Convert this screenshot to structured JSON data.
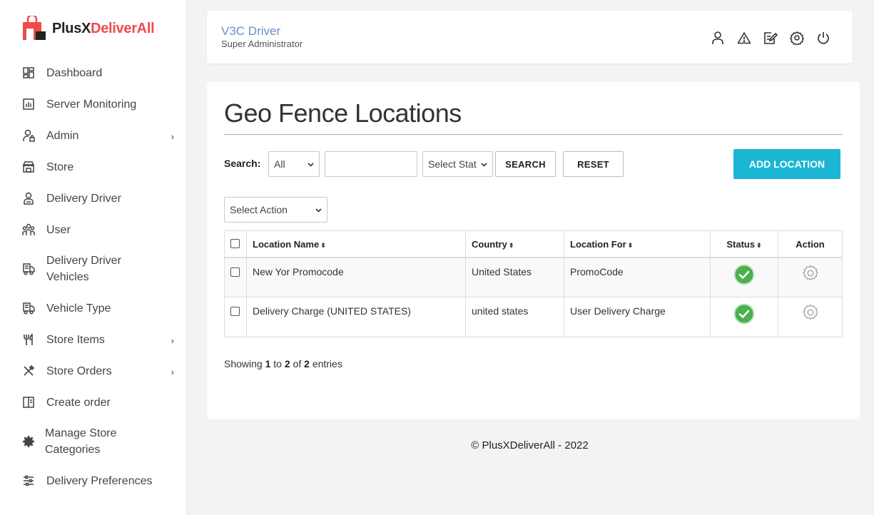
{
  "brand": {
    "name_part1": "PlusX",
    "name_part2": "DeliverAll"
  },
  "sidebar": {
    "items": [
      {
        "label": "Dashboard",
        "icon": "dashboard-icon",
        "has_submenu": false
      },
      {
        "label": "Server Monitoring",
        "icon": "chart-icon",
        "has_submenu": false
      },
      {
        "label": "Admin",
        "icon": "user-lock-icon",
        "has_submenu": true
      },
      {
        "label": "Store",
        "icon": "store-icon",
        "has_submenu": false
      },
      {
        "label": "Delivery Driver",
        "icon": "driver-icon",
        "has_submenu": false
      },
      {
        "label": "User",
        "icon": "users-icon",
        "has_submenu": false
      },
      {
        "label": "Delivery Driver Vehicles",
        "icon": "truck-icon",
        "has_submenu": false
      },
      {
        "label": "Vehicle Type",
        "icon": "truck-icon",
        "has_submenu": false
      },
      {
        "label": "Store Items",
        "icon": "utensils-icon",
        "has_submenu": true
      },
      {
        "label": "Store Orders",
        "icon": "cutlery-cross-icon",
        "has_submenu": true
      },
      {
        "label": "Create order",
        "icon": "book-icon",
        "has_submenu": false
      },
      {
        "label": "Manage Store Categories",
        "icon": "gear-fill-icon",
        "has_submenu": false
      },
      {
        "label": "Delivery Preferences",
        "icon": "sliders-icon",
        "has_submenu": false
      }
    ],
    "chevron": "›"
  },
  "header": {
    "user_name": "V3C Driver",
    "user_role": "Super Administrator",
    "icons": [
      "profile-icon",
      "alert-icon",
      "edit-icon",
      "settings-icon",
      "power-icon"
    ]
  },
  "main": {
    "title": "Geo Fence Locations",
    "search_label": "Search:",
    "search_field_select": "All",
    "search_input_value": "",
    "status_select": "Select Stat",
    "search_button": "SEARCH",
    "reset_button": "RESET",
    "add_button": "ADD LOCATION",
    "action_select": "Select Action",
    "table": {
      "columns": [
        "Location Name",
        "Country",
        "Location For",
        "Status",
        "Action"
      ],
      "sort_glyph": "⬍",
      "rows": [
        {
          "name": "New Yor Promocode",
          "country": "United States",
          "location_for": "PromoCode",
          "status": "active"
        },
        {
          "name": "Delivery Charge (UNITED STATES)",
          "country": "united states",
          "location_for": "User Delivery Charge",
          "status": "active"
        }
      ]
    },
    "showing": {
      "prefix": "Showing",
      "from": "1",
      "to_word": "to",
      "to": "2",
      "of_word": "of",
      "total": "2",
      "suffix": "entries"
    }
  },
  "footer": {
    "text": "© PlusXDeliverAll - 2022"
  },
  "colors": {
    "brand_red": "#ef4b4b",
    "accent_cyan": "#1ab6d4",
    "status_green": "#4caf50",
    "user_blue": "#6b8cc7"
  }
}
